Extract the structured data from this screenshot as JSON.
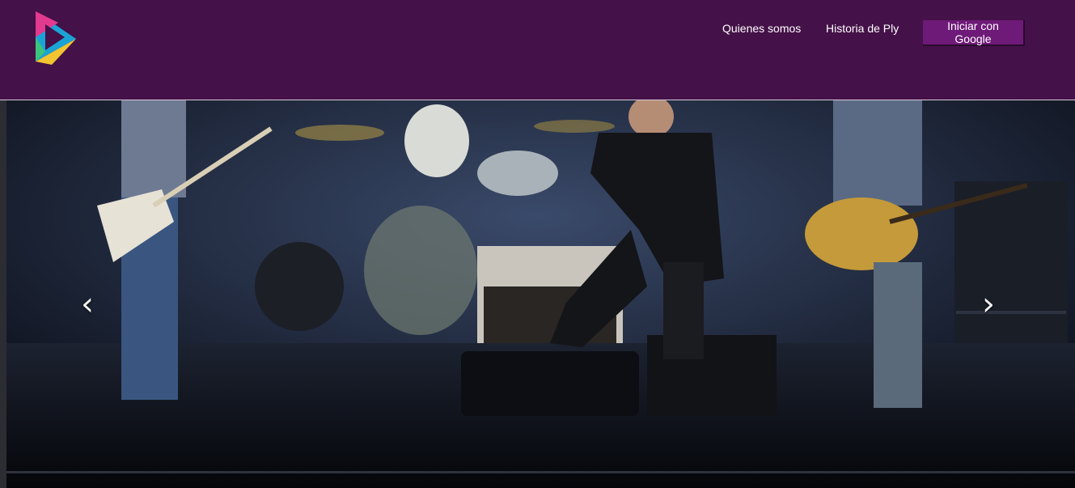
{
  "header": {
    "nav": [
      {
        "label": "Quienes somos"
      },
      {
        "label": "Historia de Ply"
      }
    ],
    "login_label": "Iniciar con Google"
  },
  "carousel": {
    "prev_glyph": "‹",
    "next_glyph": "›",
    "slide_description_icon": "concert-photo"
  },
  "colors": {
    "navbar_bg": "#441148",
    "button_bg": "#6e1a78",
    "logo_blue": "#1aa3d6",
    "logo_pink": "#e23a8f",
    "logo_yellow": "#f3c431",
    "logo_green": "#3cc47c"
  }
}
